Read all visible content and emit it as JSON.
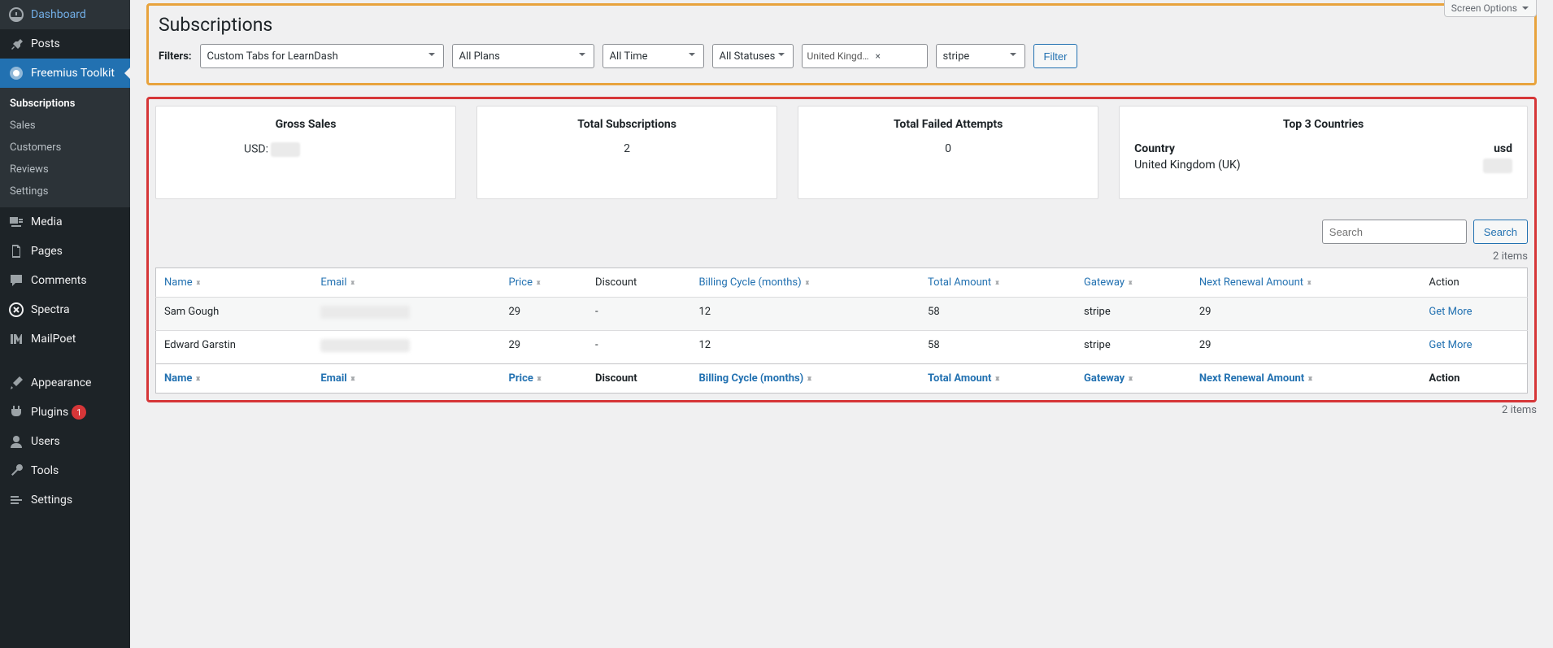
{
  "sidebar": {
    "items": [
      {
        "label": "Dashboard"
      },
      {
        "label": "Posts"
      },
      {
        "label": "Freemius Toolkit"
      },
      {
        "label": "Media"
      },
      {
        "label": "Pages"
      },
      {
        "label": "Comments"
      },
      {
        "label": "Spectra"
      },
      {
        "label": "MailPoet"
      },
      {
        "label": "Appearance"
      },
      {
        "label": "Plugins",
        "badge": "1"
      },
      {
        "label": "Users"
      },
      {
        "label": "Tools"
      },
      {
        "label": "Settings"
      }
    ],
    "submenu": [
      {
        "label": "Subscriptions"
      },
      {
        "label": "Sales"
      },
      {
        "label": "Customers"
      },
      {
        "label": "Reviews"
      },
      {
        "label": "Settings"
      }
    ]
  },
  "header": {
    "screen_options": "Screen Options",
    "title": "Subscriptions"
  },
  "filters": {
    "label": "Filters:",
    "product": "Custom Tabs for LearnDash",
    "plan": "All Plans",
    "time": "All Time",
    "status": "All Statuses",
    "country": "United Kingd…",
    "gateway": "stripe",
    "button": "Filter"
  },
  "stats": {
    "gross_title": "Gross Sales",
    "gross_usd_label": "USD:",
    "subs_title": "Total Subscriptions",
    "subs_value": "2",
    "failed_title": "Total Failed Attempts",
    "failed_value": "0",
    "top_title": "Top 3 Countries",
    "country_hdr": "Country",
    "usd_hdr": "usd",
    "country_row": "United Kingdom (UK)"
  },
  "search": {
    "placeholder": "Search",
    "button": "Search"
  },
  "count": "2 items",
  "columns": {
    "name": "Name",
    "email": "Email",
    "price": "Price",
    "discount": "Discount",
    "billing": "Billing Cycle (months)",
    "total": "Total Amount",
    "gateway": "Gateway",
    "renewal": "Next Renewal Amount",
    "action": "Action"
  },
  "rows": [
    {
      "name": "Sam Gough",
      "price": "29",
      "discount": "-",
      "billing": "12",
      "total": "58",
      "gateway": "stripe",
      "renewal": "29",
      "action": "Get More"
    },
    {
      "name": "Edward Garstin",
      "price": "29",
      "discount": "-",
      "billing": "12",
      "total": "58",
      "gateway": "stripe",
      "renewal": "29",
      "action": "Get More"
    }
  ]
}
